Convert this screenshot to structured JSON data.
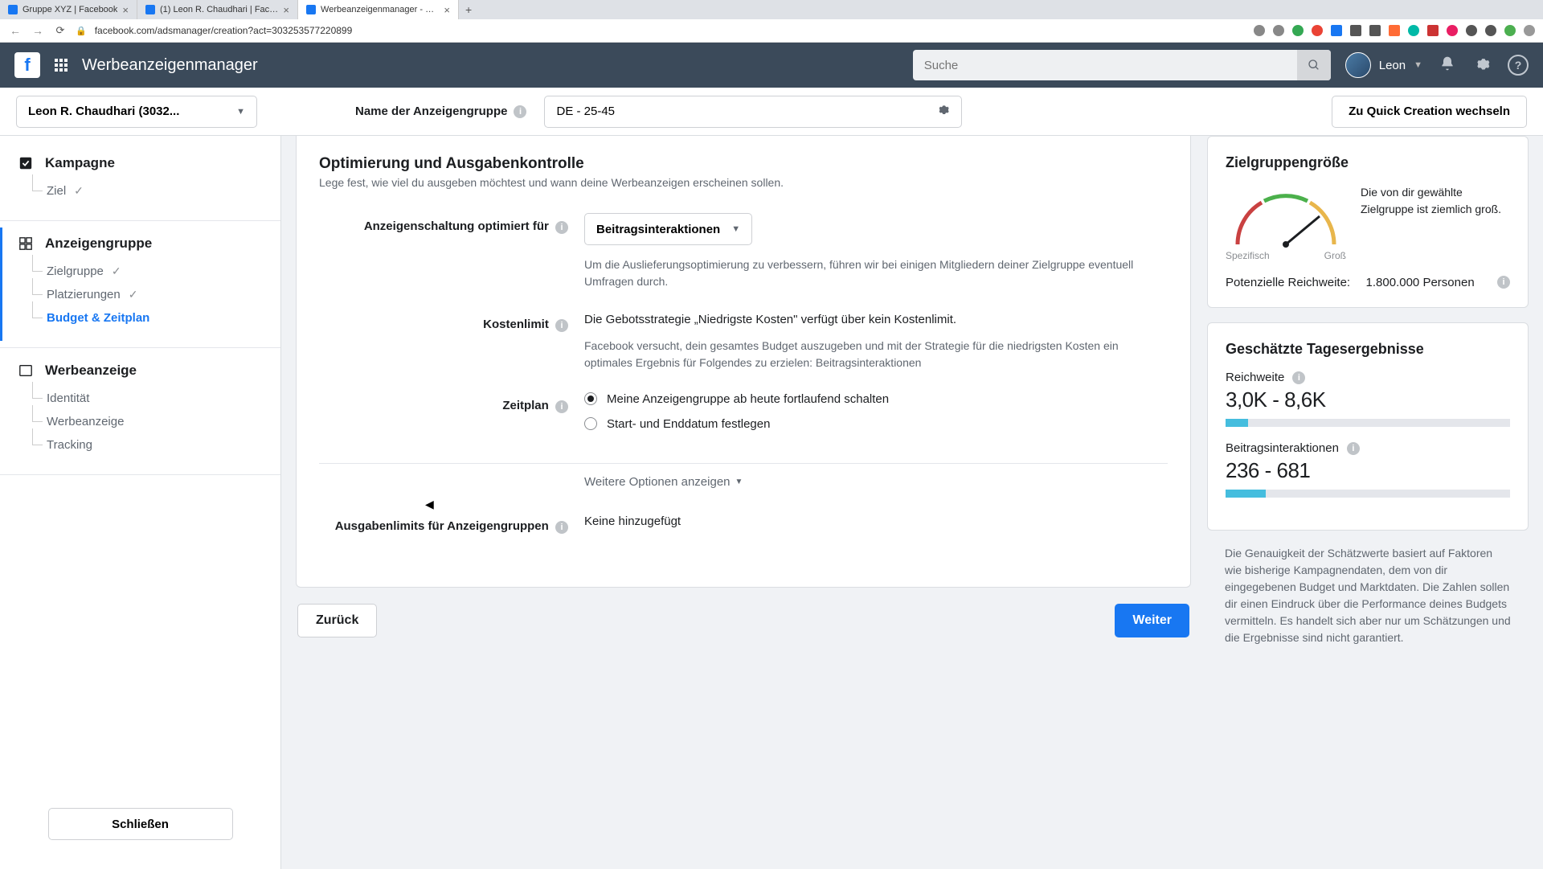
{
  "browser": {
    "tabs": [
      {
        "title": "Gruppe XYZ | Facebook"
      },
      {
        "title": "(1) Leon R. Chaudhari | Faceb..."
      },
      {
        "title": "Werbeanzeigenmanager - Cre..."
      }
    ],
    "url": "facebook.com/adsmanager/creation?act=303253577220899"
  },
  "topnav": {
    "app_title": "Werbeanzeigenmanager",
    "search_placeholder": "Suche",
    "user_name": "Leon"
  },
  "subheader": {
    "account": "Leon R. Chaudhari (3032...",
    "adset_name_label": "Name der Anzeigengruppe",
    "adset_name_value": "DE - 25-45",
    "quick_creation": "Zu Quick Creation wechseln"
  },
  "sidebar": {
    "campaign": {
      "title": "Kampagne",
      "goal": "Ziel"
    },
    "adset": {
      "title": "Anzeigengruppe",
      "audience": "Zielgruppe",
      "placements": "Platzierungen",
      "budget": "Budget & Zeitplan"
    },
    "ad": {
      "title": "Werbeanzeige",
      "identity": "Identität",
      "creative": "Werbeanzeige",
      "tracking": "Tracking"
    },
    "close": "Schließen"
  },
  "form": {
    "section_title": "Optimierung und Ausgabenkontrolle",
    "section_subtitle": "Lege fest, wie viel du ausgeben möchtest und wann deine Werbeanzeigen erscheinen sollen.",
    "optimization_label": "Anzeigenschaltung optimiert für",
    "optimization_value": "Beitragsinteraktionen",
    "optimization_help": "Um die Auslieferungsoptimierung zu verbessern, führen wir bei einigen Mitgliedern deiner Zielgruppe eventuell Umfragen durch.",
    "cost_label": "Kostenlimit",
    "cost_text": "Die Gebotsstrategie „Niedrigste Kosten\" verfügt über kein Kostenlimit.",
    "cost_sub": "Facebook versucht, dein gesamtes Budget auszugeben und mit der Strategie für die niedrigsten Kosten ein optimales Ergebnis für Folgendes zu erzielen: Beitragsinteraktionen",
    "schedule_label": "Zeitplan",
    "schedule_opt1": "Meine Anzeigengruppe ab heute fortlaufend schalten",
    "schedule_opt2": "Start- und Enddatum festlegen",
    "more_options": "Weitere Optionen anzeigen",
    "spend_limit_label": "Ausgabenlimits für Anzeigengruppen",
    "spend_limit_value": "Keine hinzugefügt",
    "back": "Zurück",
    "next": "Weiter"
  },
  "right": {
    "audience_title": "Zielgruppengröße",
    "gauge_low": "Spezifisch",
    "gauge_high": "Groß",
    "gauge_desc": "Die von dir gewählte Zielgruppe ist ziemlich groß.",
    "reach_label": "Potenzielle Reichweite:",
    "reach_value": "1.800.000 Personen",
    "daily_title": "Geschätzte Tagesergebnisse",
    "reach_est_label": "Reichweite",
    "reach_est_value": "3,0K - 8,6K",
    "engage_label": "Beitragsinteraktionen",
    "engage_value": "236 - 681",
    "disclaimer": "Die Genauigkeit der Schätzwerte basiert auf Faktoren wie bisherige Kampagnendaten, dem von dir eingegebenen Budget und Marktdaten. Die Zahlen sollen dir einen Eindruck über die Performance deines Budgets vermitteln. Es handelt sich aber nur um Schätzungen und die Ergebnisse sind nicht garantiert."
  }
}
